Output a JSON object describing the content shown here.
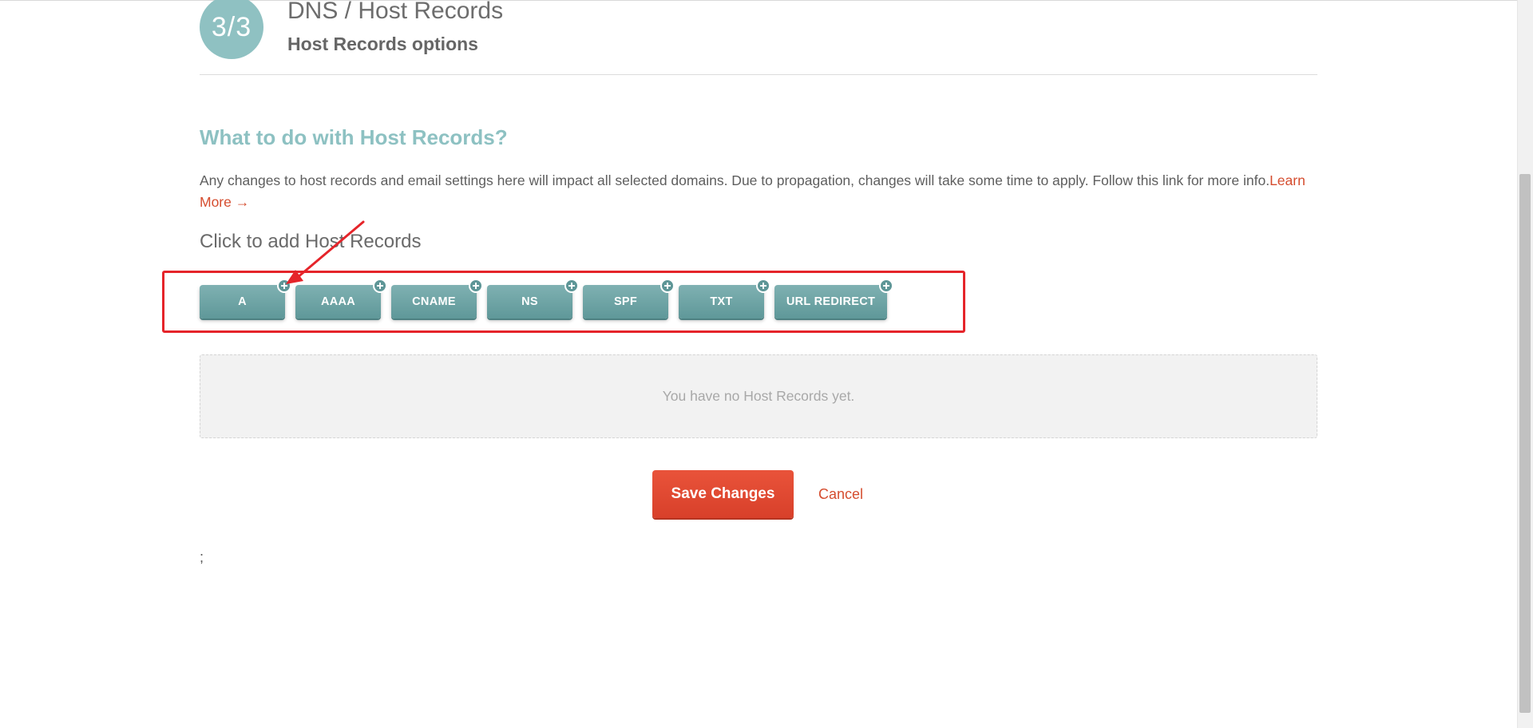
{
  "header": {
    "step": "3/3",
    "title": "DNS / Host Records",
    "subtitle": "Host Records options"
  },
  "section": {
    "heading": "What to do with Host Records?",
    "description": "Any changes to host records and email settings here will impact all selected domains. Due to propagation, changes will take some time to apply. Follow this link for more info.",
    "learn_more": "Learn More →",
    "add_label": "Click to add Host Records"
  },
  "record_buttons": [
    "A",
    "AAAA",
    "CNAME",
    "NS",
    "SPF",
    "TXT",
    "URL REDIRECT"
  ],
  "empty_state": "You have no Host Records yet.",
  "actions": {
    "save": "Save Changes",
    "cancel": "Cancel"
  },
  "footer_text": ";",
  "colors": {
    "accent_teal": "#8dc1c2",
    "button_teal": "#6aa3a4",
    "primary_red": "#e04a32",
    "annotation_red": "#e5242a"
  }
}
